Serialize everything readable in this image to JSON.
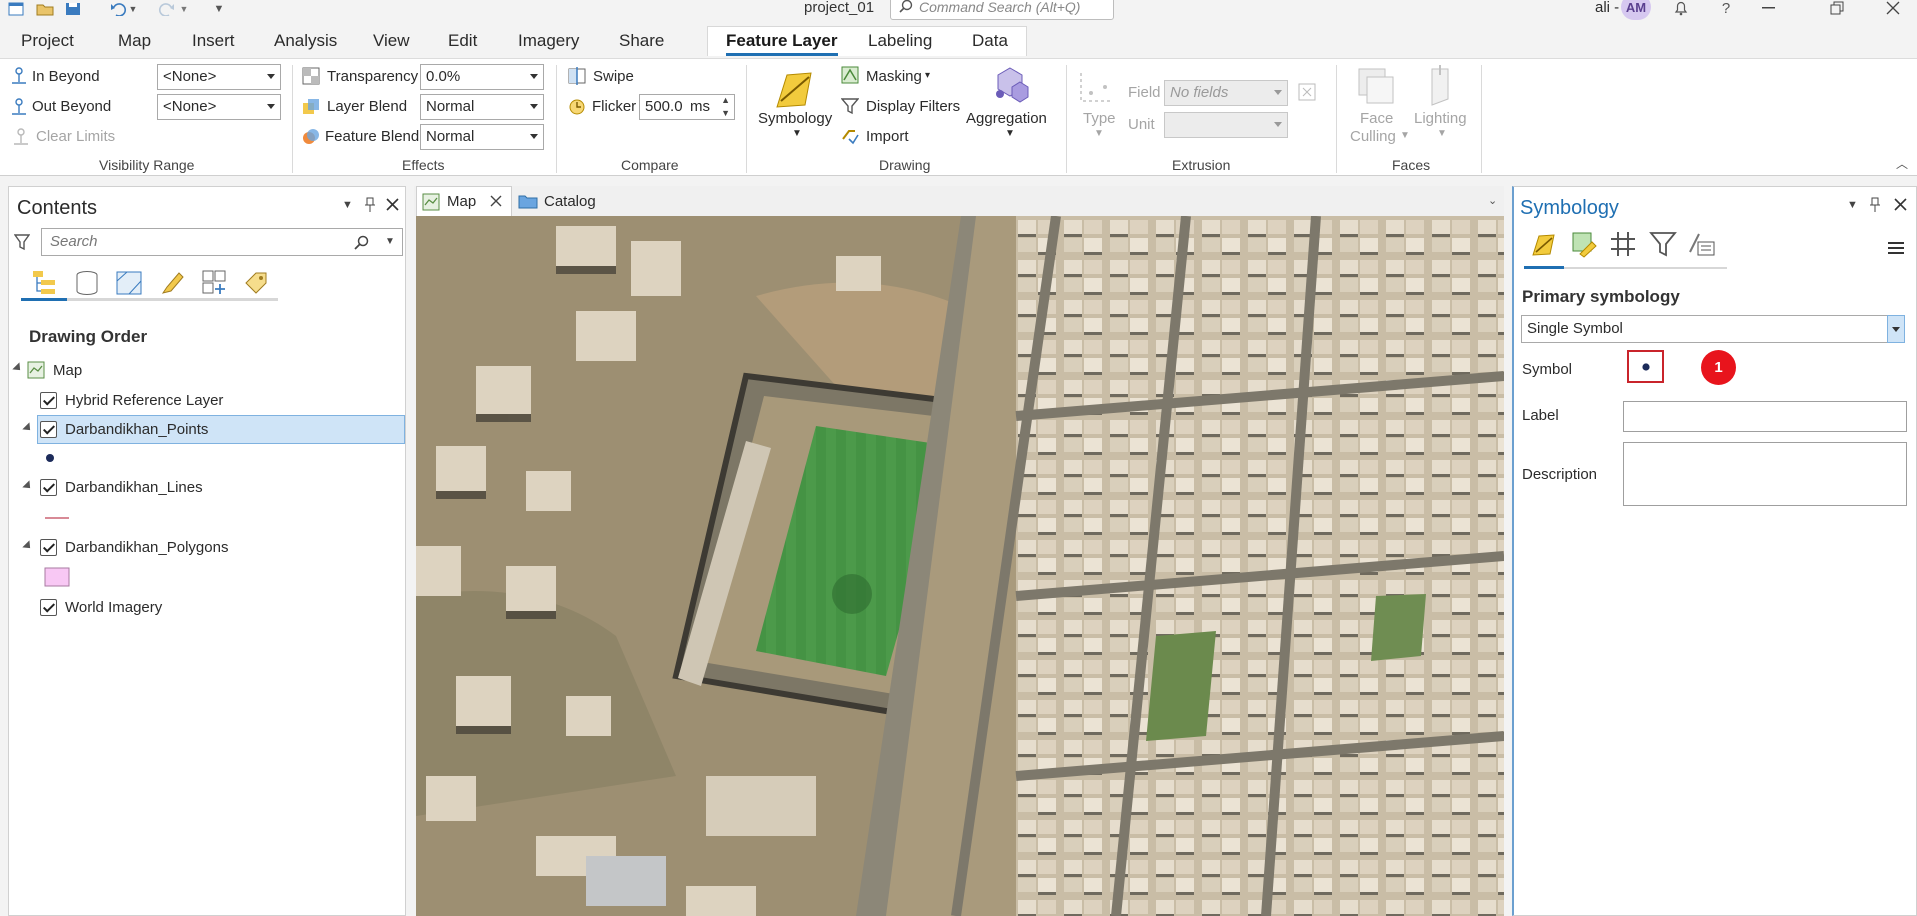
{
  "app": {
    "project_name": "project_01",
    "command_search_placeholder": "Command Search (Alt+Q)",
    "user_name": "ali - GIS",
    "user_initials": "AM"
  },
  "ribbon_tabs": [
    {
      "label": "Project"
    },
    {
      "label": "Map"
    },
    {
      "label": "Insert"
    },
    {
      "label": "Analysis"
    },
    {
      "label": "View"
    },
    {
      "label": "Edit"
    },
    {
      "label": "Imagery"
    },
    {
      "label": "Share"
    },
    {
      "label": "Feature Layer",
      "active": true
    },
    {
      "label": "Labeling"
    },
    {
      "label": "Data"
    }
  ],
  "ribbon": {
    "visibility": {
      "in_beyond": "In Beyond",
      "out_beyond": "Out Beyond",
      "clear_limits": "Clear Limits",
      "in_beyond_value": "<None>",
      "out_beyond_value": "<None>",
      "title": "Visibility Range"
    },
    "effects": {
      "transparency": "Transparency",
      "transparency_value": "0.0%",
      "layer_blend": "Layer Blend",
      "layer_blend_value": "Normal",
      "feature_blend": "Feature Blend",
      "feature_blend_value": "Normal",
      "title": "Effects"
    },
    "compare": {
      "swipe": "Swipe",
      "flicker": "Flicker",
      "flicker_value": "500.0",
      "flicker_unit": "ms",
      "title": "Compare"
    },
    "drawing": {
      "symbology": "Symbology",
      "masking": "Masking",
      "display_filters": "Display Filters",
      "import": "Import",
      "aggregation": "Aggregation",
      "title": "Drawing"
    },
    "extrusion": {
      "type": "Type",
      "field": "Field",
      "field_value": "No fields",
      "unit": "Unit",
      "title": "Extrusion"
    },
    "faces": {
      "face_culling_1": "Face",
      "face_culling_2": "Culling",
      "lighting": "Lighting",
      "title": "Faces"
    }
  },
  "contents": {
    "title": "Contents",
    "search_placeholder": "Search",
    "section_title": "Drawing Order",
    "map_label": "Map",
    "layers": [
      {
        "name": "Hybrid Reference Layer"
      },
      {
        "name": "Darbandikhan_Points",
        "selected": true
      },
      {
        "name": "Darbandikhan_Lines"
      },
      {
        "name": "Darbandikhan_Polygons"
      },
      {
        "name": "World Imagery"
      }
    ],
    "colors": {
      "point": "#1c2b5a",
      "line": "#d88a96",
      "polygon_fill": "#f8c8f4",
      "polygon_stroke": "#a77aa0"
    }
  },
  "map_tabs": [
    {
      "label": "Map",
      "active": true
    },
    {
      "label": "Catalog"
    }
  ],
  "symbology": {
    "title": "Symbology",
    "primary_label": "Primary symbology",
    "primary_value": "Single Symbol",
    "symbol_label": "Symbol",
    "label_label": "Label",
    "description_label": "Description",
    "callout_number": "1",
    "callout_color": "#e8141c"
  }
}
